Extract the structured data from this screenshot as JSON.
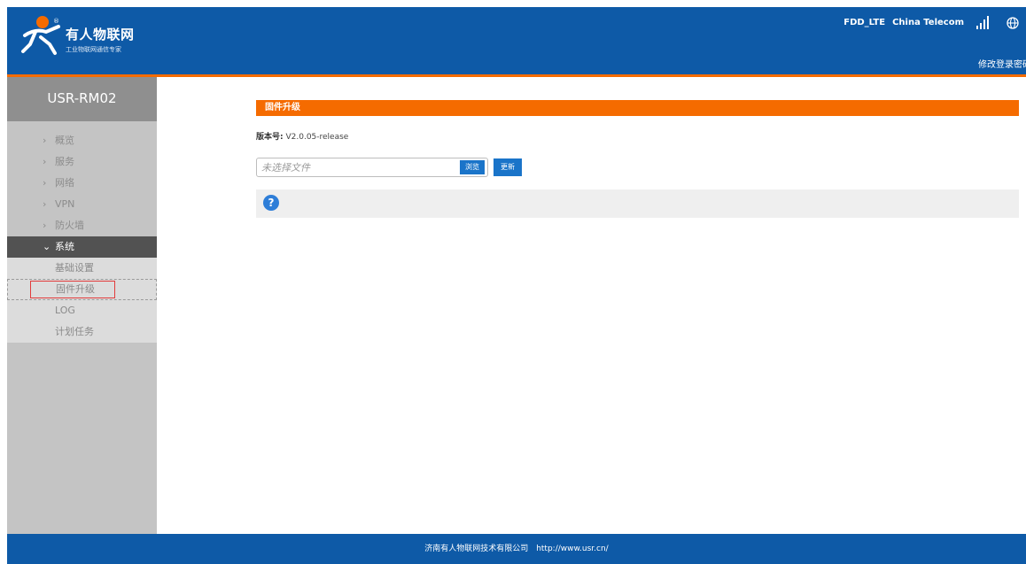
{
  "header": {
    "brand_title": "有人物联网",
    "brand_subtitle": "工业物联网通信专家",
    "registered_mark": "®",
    "network_type": "FDD_LTE",
    "carrier": "China Telecom",
    "change_password": "修改登录密码"
  },
  "sidebar": {
    "device_name": "USR-RM02",
    "items": [
      {
        "label": "概览",
        "chevron": "›"
      },
      {
        "label": "服务",
        "chevron": "›"
      },
      {
        "label": "网络",
        "chevron": "›"
      },
      {
        "label": "VPN",
        "chevron": "›"
      },
      {
        "label": "防火墙",
        "chevron": "›"
      },
      {
        "label": "系统",
        "chevron": "⌄"
      }
    ],
    "sub_items": [
      {
        "label": "基础设置"
      },
      {
        "label": "固件升级"
      },
      {
        "label": "LOG"
      },
      {
        "label": "计划任务"
      }
    ]
  },
  "main": {
    "section_title": "固件升级",
    "version_label": "版本号:",
    "version_value": "V2.0.05-release",
    "file_placeholder": "未选择文件",
    "browse_label": "浏览",
    "update_label": "更新",
    "help_icon_char": "?"
  },
  "footer": {
    "company": "济南有人物联网技术有限公司",
    "url": "http://www.usr.cn/"
  },
  "colors": {
    "header_blue": "#0e5aa7",
    "accent_orange": "#f56b00",
    "button_blue": "#1a74c9",
    "sidebar_gray": "#c4c4c4",
    "highlight_red": "#e23b3b"
  },
  "icons": [
    "logo-figure-icon",
    "signal-strength-icon",
    "globe-icon",
    "help-icon"
  ]
}
